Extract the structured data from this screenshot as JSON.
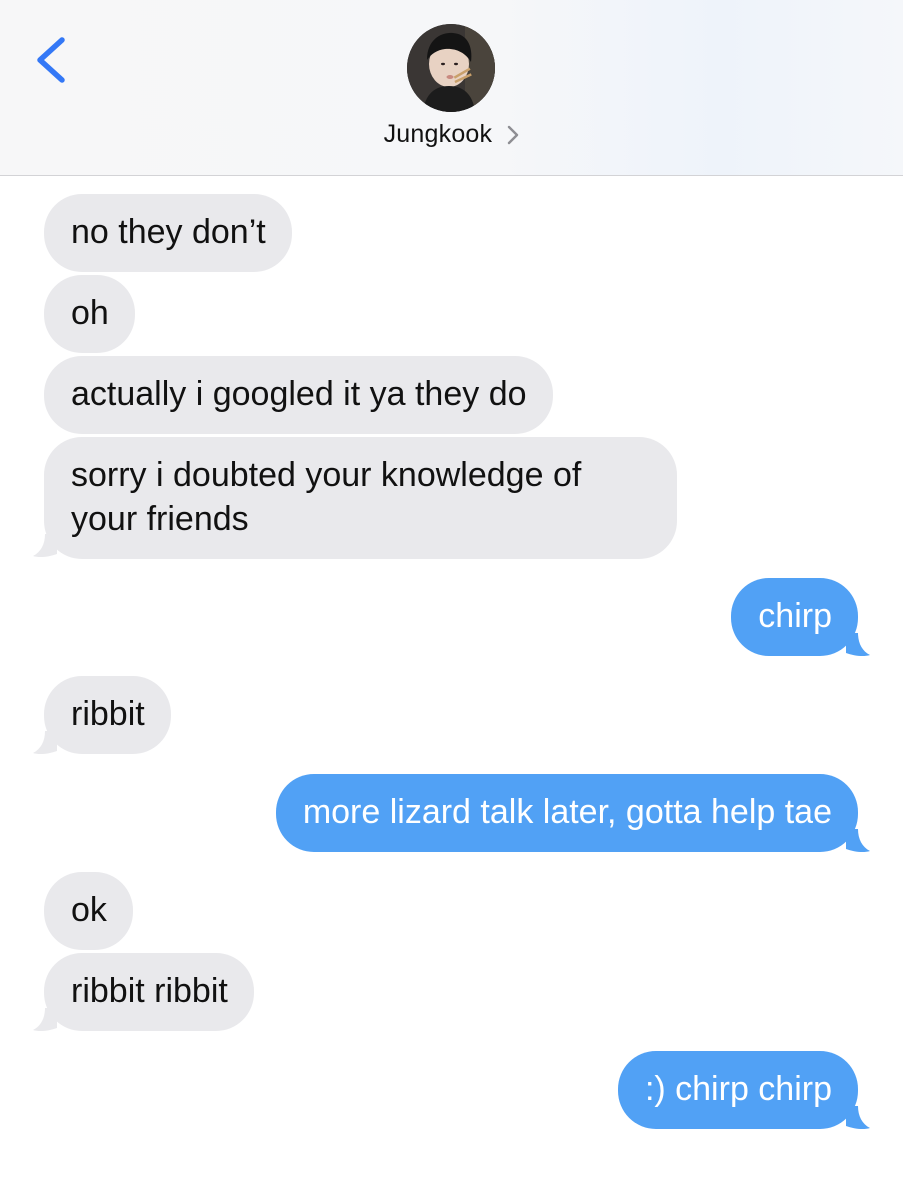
{
  "header": {
    "contact_name": "Jungkook",
    "back_icon": "chevron-left-icon",
    "detail_icon": "chevron-right-icon",
    "accent_color": "#3478f6"
  },
  "colors": {
    "incoming_bubble": "#e9e9ec",
    "outgoing_bubble": "#51a1f5",
    "incoming_text": "#111111",
    "outgoing_text": "#ffffff"
  },
  "messages": [
    {
      "direction": "incoming",
      "text": "no they don’t"
    },
    {
      "direction": "incoming",
      "text": "oh"
    },
    {
      "direction": "incoming",
      "text": "actually i googled it ya they do"
    },
    {
      "direction": "incoming",
      "text": "sorry i doubted your knowledge of your friends"
    },
    {
      "direction": "outgoing",
      "text": "chirp"
    },
    {
      "direction": "incoming",
      "text": "ribbit"
    },
    {
      "direction": "outgoing",
      "text": "more lizard talk later, gotta help tae"
    },
    {
      "direction": "incoming",
      "text": "ok"
    },
    {
      "direction": "incoming",
      "text": "ribbit ribbit"
    },
    {
      "direction": "outgoing",
      "text": ":) chirp chirp"
    }
  ]
}
